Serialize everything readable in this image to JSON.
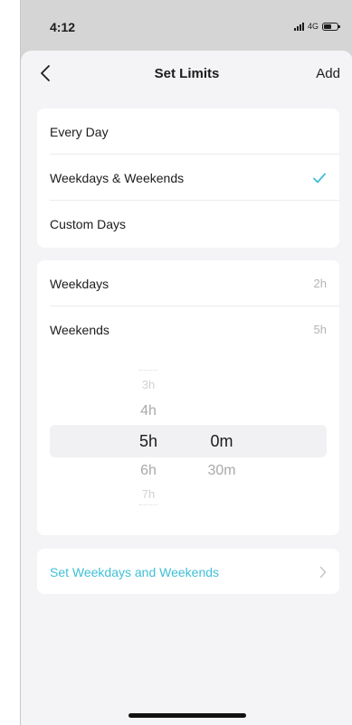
{
  "status_bar": {
    "time": "4:12",
    "network": "4G"
  },
  "nav": {
    "title": "Set Limits",
    "add_label": "Add"
  },
  "day_options": {
    "items": [
      {
        "label": "Every Day",
        "selected": false
      },
      {
        "label": "Weekdays & Weekends",
        "selected": true
      },
      {
        "label": "Custom Days",
        "selected": false
      }
    ]
  },
  "limits": {
    "rows": [
      {
        "label": "Weekdays",
        "value": "2h"
      },
      {
        "label": "Weekends",
        "value": "5h"
      }
    ]
  },
  "picker": {
    "hours": {
      "above_far": "3h",
      "above": "4h",
      "selected": "5h",
      "below": "6h",
      "below_far": "7h"
    },
    "minutes": {
      "selected": "0m",
      "below": "30m"
    }
  },
  "action": {
    "label": "Set Weekdays and Weekends"
  },
  "colors": {
    "accent": "#3fbfd6",
    "sheet_background": "#f4f4f6",
    "card_background": "#ffffff",
    "muted_text": "#b4b4b4"
  },
  "icons": {
    "back": "chevron-left-icon",
    "check": "checkmark-icon",
    "chevron": "chevron-right-icon",
    "signal": "signal-icon",
    "battery": "battery-icon"
  }
}
